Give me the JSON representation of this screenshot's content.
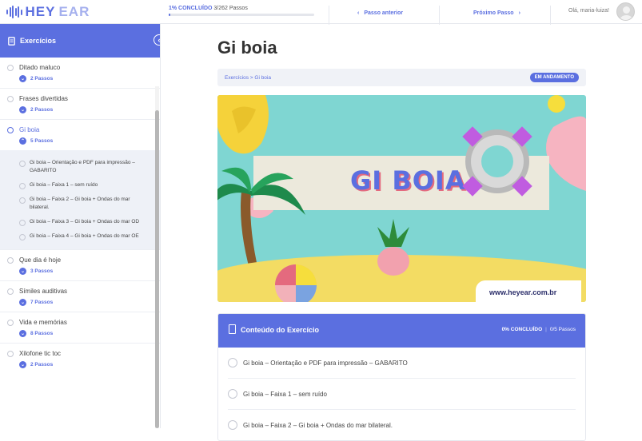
{
  "brand": {
    "left": "HEY",
    "right": "EAR"
  },
  "topbar": {
    "progress_percent": 1,
    "progress_label": "1% CONCLUÍDO",
    "progress_steps": "3/262 Passos",
    "prev_label": "Passo anterior",
    "next_label": "Próximo Passo",
    "greeting": "Olá, maria-luiza!"
  },
  "sidebar": {
    "title": "Exercícios",
    "items": [
      {
        "label": "Ditado maluco",
        "steps": "2 Passos"
      },
      {
        "label": "Frases divertidas",
        "steps": "2 Passos"
      },
      {
        "label": "Gi boia",
        "steps": "5 Passos"
      },
      {
        "label": "Que dia é hoje",
        "steps": "3 Passos"
      },
      {
        "label": "Símiles auditivas",
        "steps": "7 Passos"
      },
      {
        "label": "Vida e memórias",
        "steps": "8 Passos"
      },
      {
        "label": "Xilofone tic toc",
        "steps": "2 Passos"
      }
    ],
    "sub_items": [
      "Gi boia – Orientação e PDF para impressão – GABARITO",
      "Gi boia – Faixa 1 – sem ruído",
      "Gi boia – Faixa 2 – Gi boia + Ondas do mar bilateral.",
      "Gi boia – Faixa 3 – Gi boia + Ondas do mar OD",
      "Gi boia – Faixa 4 – Gi boia + Ondas do mar OE"
    ]
  },
  "main": {
    "title": "Gi boia",
    "breadcrumb": "Exercícios > Gi boia",
    "status_badge": "EM ANDAMENTO",
    "banner_title": "GI BOIA",
    "banner_url": "www.heyear.com.br",
    "content": {
      "title": "Conteúdo do Exercício",
      "percent_label": "0% CONCLUÍDO",
      "steps_label": "0/5 Passos",
      "rows": [
        "Gi boia – Orientação e PDF para impressão – GABARITO",
        "Gi boia – Faixa 1 – sem ruído",
        "Gi boia – Faixa 2 – Gi boia + Ondas do mar bilateral."
      ]
    }
  },
  "colors": {
    "accent": "#5b6fe0",
    "banner_bg": "#7fd6d2",
    "sand": "#f3dc63"
  }
}
